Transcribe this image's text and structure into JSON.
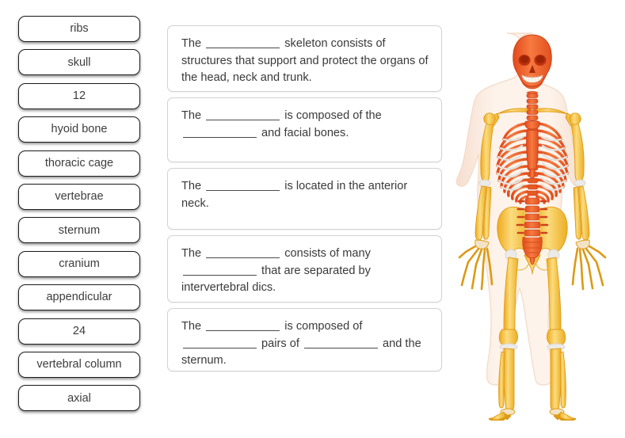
{
  "activity": {
    "type": "drag-and-drop fill-in-the-blank worksheet",
    "topic": "Axial skeleton"
  },
  "tiles": [
    {
      "label": "ribs"
    },
    {
      "label": "skull"
    },
    {
      "label": "12"
    },
    {
      "label": "hyoid bone"
    },
    {
      "label": "thoracic cage"
    },
    {
      "label": "vertebrae"
    },
    {
      "label": "sternum"
    },
    {
      "label": "cranium"
    },
    {
      "label": "appendicular"
    },
    {
      "label": "24"
    },
    {
      "label": "vertebral column"
    },
    {
      "label": "axial"
    }
  ],
  "cards": [
    {
      "id": "card-1",
      "parts": [
        "The ",
        "",
        " skeleton consists of structures that support and protect the organs of the head, neck and trunk."
      ],
      "blanks": 1,
      "seg1": "The ",
      "seg2": " skeleton consists of structures that support and protect the organs of the head, neck and trunk."
    },
    {
      "id": "card-2",
      "seg1": "The ",
      "seg2": " is composed of the ",
      "seg3": " and facial bones."
    },
    {
      "id": "card-3",
      "seg1": "The ",
      "seg2": " is located in the anterior neck."
    },
    {
      "id": "card-4",
      "seg1": "The ",
      "seg2": " consists of many ",
      "seg3": " that are separated by intervertebral dics."
    },
    {
      "id": "card-5",
      "seg1": "The ",
      "seg2": " is composed of ",
      "seg3": " pairs of ",
      "seg4": " and the sternum."
    }
  ],
  "figure": {
    "name": "human skeleton diagram",
    "description": "Front view of a human body silhouette with the skeleton visible; the axial skeleton (skull, vertebral column, rib cage, sternum, sacrum) is highlighted in red-orange and the appendicular skeleton (arms, legs, shoulder girdle, pelvis, hands, feet) is shown in yellow.",
    "colors": {
      "axial": "#ea5a2a",
      "axial_light": "#f4793f",
      "appendicular": "#f5c03a",
      "appendicular_light": "#fbdc7e",
      "body_outline": "#f8e6d8",
      "body_fill": "#fdf1e6",
      "cartilage": "#e8e8e6"
    }
  }
}
